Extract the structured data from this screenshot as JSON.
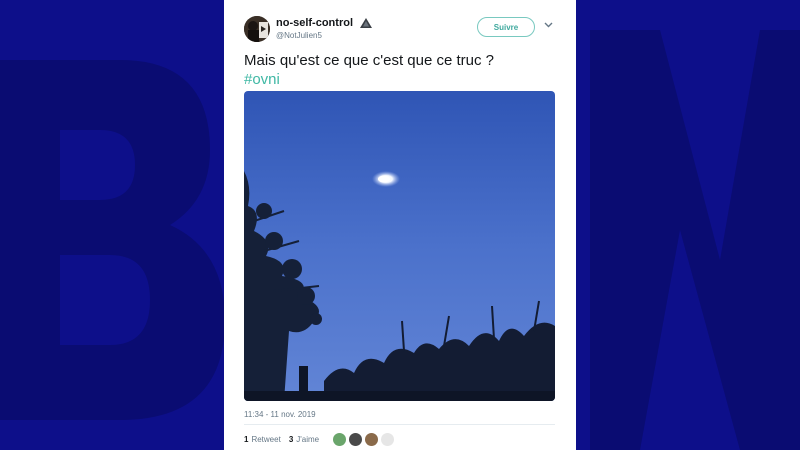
{
  "tweet": {
    "display_name": "no-self-control",
    "handle": "@NotJulien5",
    "follow_label": "Suivre",
    "text": "Mais qu'est ce que c'est que ce truc ?",
    "hashtag": "#ovni",
    "timestamp": "11:34 - 11 nov. 2019",
    "retweet_count": "1",
    "retweet_label": "Retweet",
    "like_count": "3",
    "like_label": "J'aime"
  },
  "colors": {
    "background": "#0d0f8a",
    "follow_accent": "#3fa99e",
    "hashtag": "#3fb8a4",
    "sky": "#4f74cf"
  },
  "icons": [
    "verified-triangle-icon",
    "chevron-down-icon"
  ]
}
